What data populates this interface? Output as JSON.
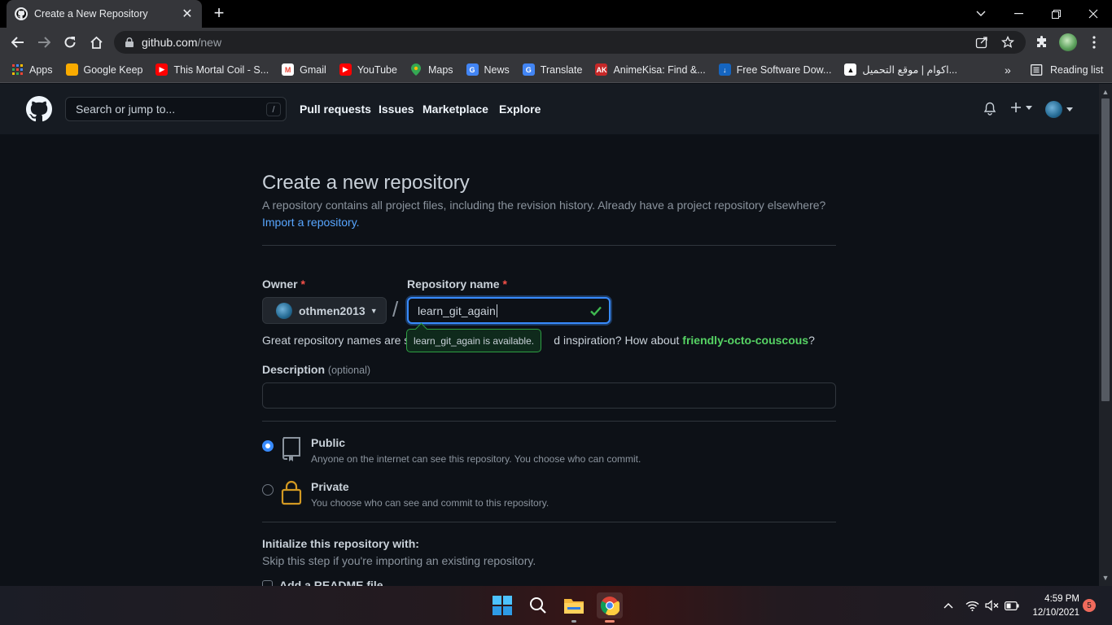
{
  "browser": {
    "tab_title": "Create a New Repository",
    "tab_close": "✕",
    "new_tab": "+",
    "url_host": "github.com",
    "url_path": "/new",
    "bookmarks": [
      {
        "label": "Apps",
        "icon": "apps-grid-icon",
        "color": "#e8eaed"
      },
      {
        "label": "Google Keep",
        "icon": "google-keep-icon",
        "color": "#f9ab00"
      },
      {
        "label": "This Mortal Coil - S...",
        "icon": "youtube-icon",
        "color": "#ff0000"
      },
      {
        "label": "Gmail",
        "icon": "gmail-icon",
        "color": "#ea4335"
      },
      {
        "label": "YouTube",
        "icon": "youtube-icon",
        "color": "#ff0000"
      },
      {
        "label": "Maps",
        "icon": "maps-pin-icon",
        "color": "#34a853"
      },
      {
        "label": "News",
        "icon": "google-news-icon",
        "color": "#4285f4"
      },
      {
        "label": "Translate",
        "icon": "google-translate-icon",
        "color": "#4285f4"
      },
      {
        "label": "AnimeKisa: Find &...",
        "icon": "animekisa-icon",
        "color": "#c62828"
      },
      {
        "label": "Free Software Dow...",
        "icon": "download-site-icon",
        "color": "#1565c0"
      },
      {
        "label": "اكوام | موقع التحميل...",
        "icon": "akwam-icon",
        "color": "#ffffff"
      }
    ],
    "bookmarks_more": "»",
    "reading_list": "Reading list"
  },
  "github": {
    "search_placeholder": "Search or jump to...",
    "search_key": "/",
    "nav": [
      "Pull requests",
      "Issues",
      "Marketplace",
      "Explore"
    ]
  },
  "page": {
    "title": "Create a new repository",
    "subtitle": "A repository contains all project files, including the revision history. Already have a project repository elsewhere?",
    "import_link": "Import a repository.",
    "owner_label": "Owner",
    "required_mark": "*",
    "owner_value": "othmen2013",
    "separator": "/",
    "repo_label": "Repository name",
    "repo_value": "learn_git_again",
    "tooltip": "learn_git_again is available.",
    "hint_start": "Great repository names are s",
    "hint_mid": "d inspiration? How about ",
    "hint_suggestion": "friendly-octo-couscous",
    "hint_end": "?",
    "description_label": "Description",
    "description_optional": "(optional)",
    "description_value": "",
    "visibility": {
      "public_title": "Public",
      "public_desc": "Anyone on the internet can see this repository. You choose who can commit.",
      "private_title": "Private",
      "private_desc": "You choose who can see and commit to this repository.",
      "selected": "public"
    },
    "init_title": "Initialize this repository with:",
    "init_sub": "Skip this step if you're importing an existing repository.",
    "readme_label": "Add a README file"
  },
  "taskbar": {
    "time": "4:59 PM",
    "date": "12/10/2021",
    "notifications": "5"
  }
}
